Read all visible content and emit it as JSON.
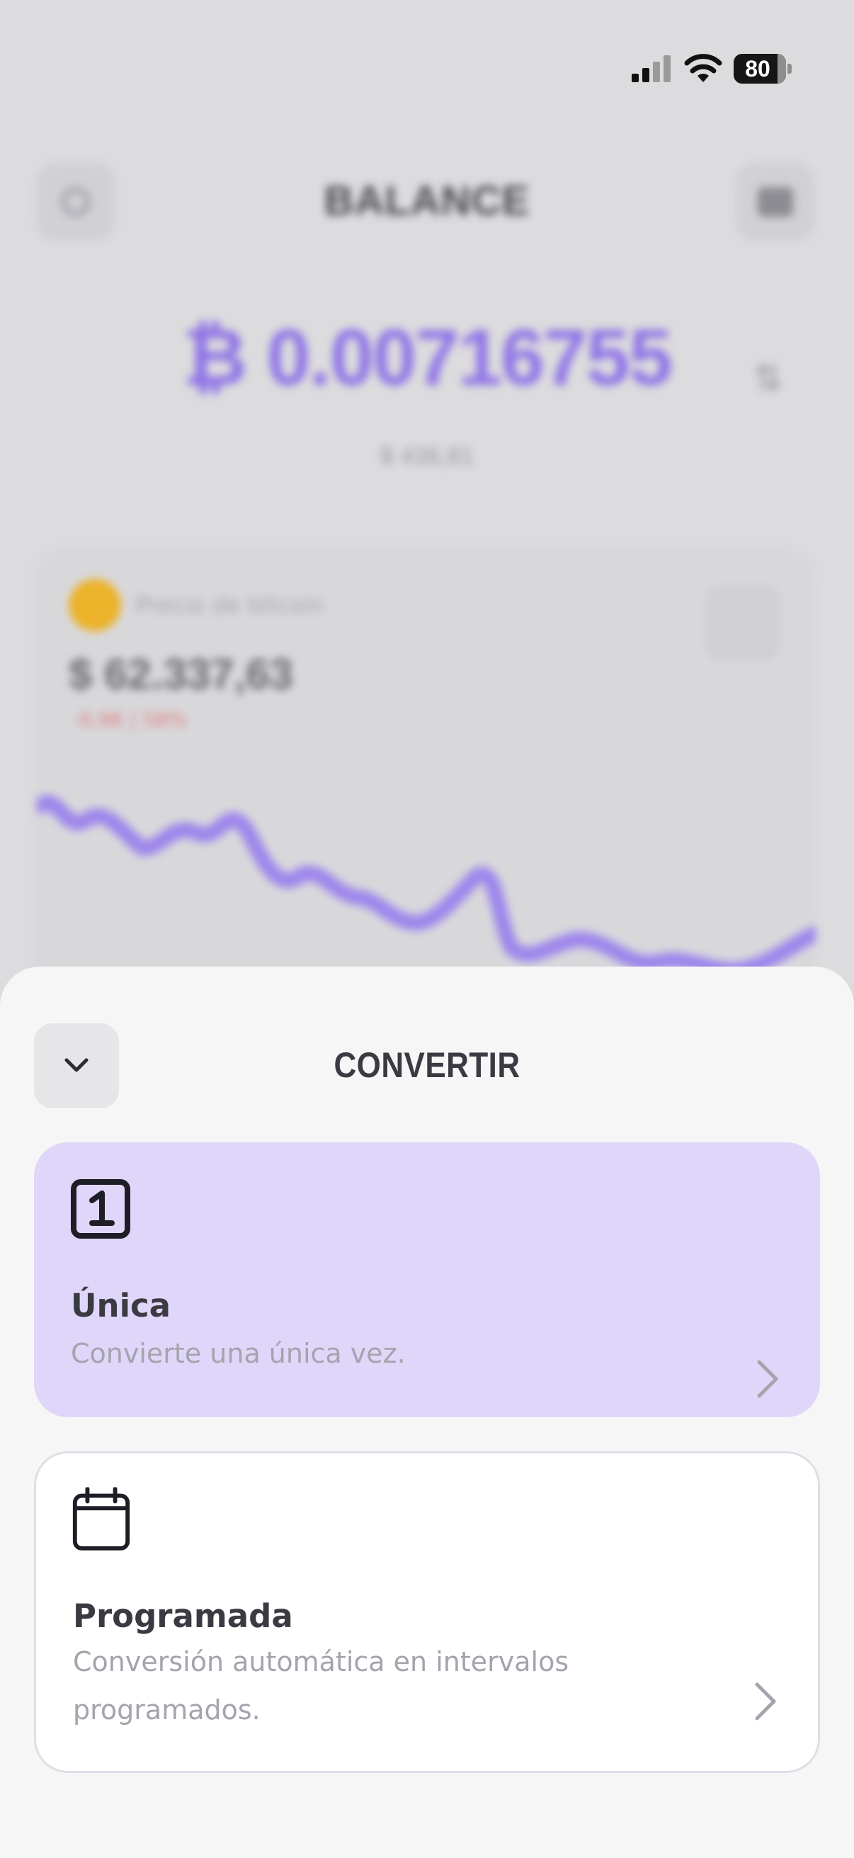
{
  "status_bar": {
    "battery_level": "80",
    "icons": [
      "cellular-signal-icon",
      "wifi-icon",
      "battery-icon"
    ]
  },
  "background": {
    "title": "BALANCE",
    "balance": "₿ 0.00716755",
    "fiat_value": "$ 436,81",
    "card": {
      "label": "Precio de bitcoin",
      "price": "$ 62.337,63",
      "change": "-0,96 | 58%"
    }
  },
  "sheet": {
    "title": "CONVERTIR",
    "options": [
      {
        "title": "Única",
        "description": "Convierte una única vez.",
        "icon": "number-one-square-icon"
      },
      {
        "title": "Programada",
        "description": "Conversión automática en intervalos programados.",
        "icon": "calendar-icon"
      }
    ]
  },
  "colors": {
    "accent": "#8e73e6",
    "selected_option_bg": "#e0d6fa",
    "sheet_bg": "#f6f6f7",
    "text_primary": "#3a3a42",
    "text_secondary": "#a4a4ad"
  }
}
